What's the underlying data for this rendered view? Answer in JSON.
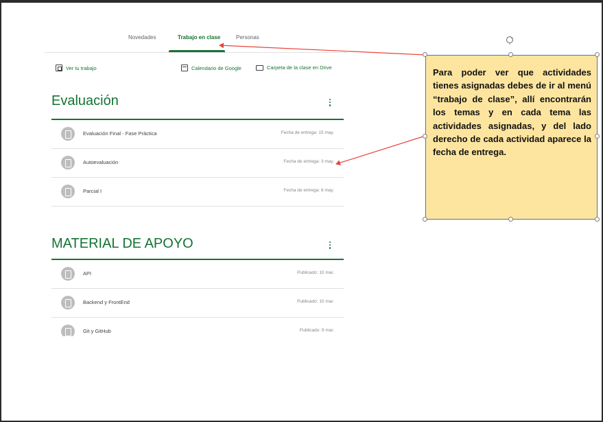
{
  "tabs": [
    {
      "label": "Novedades",
      "active": false
    },
    {
      "label": "Trabajo en clase",
      "active": true
    },
    {
      "label": "Personas",
      "active": false
    }
  ],
  "actions": {
    "view_work": "Ver tu trabajo",
    "google_calendar": "Calendario de Google",
    "drive_folder": "Carpeta de la clase en Drive"
  },
  "sections": [
    {
      "title": "Evaluación",
      "items": [
        {
          "title": "Evaluación Final - Fase Práctica",
          "date": "Fecha de entrega: 15 may."
        },
        {
          "title": "Autoevaluación",
          "date": "Fecha de entrega: 3 may."
        },
        {
          "title": "Parcial I",
          "date": "Fecha de entrega: 6 may."
        }
      ]
    },
    {
      "title": "MATERIAL DE APOYO",
      "items": [
        {
          "title": "API",
          "date": "Publicado: 10 mar."
        },
        {
          "title": "Backend y FrontEnd",
          "date": "Publicado: 10 mar."
        },
        {
          "title": "Git y GitHub",
          "date": "Publicado: 9 mar."
        }
      ]
    }
  ],
  "callout": {
    "text": "Para poder ver que actividades tienes asignadas debes de ir al menú “trabajo de clase”, allí encontrarán los temas y en cada tema las actividades asignadas, y del lado derecho de cada actividad aparece la fecha de entrega."
  },
  "colors": {
    "accent": "#137333",
    "callout_fill": "#fde5a0",
    "callout_border": "#4472c4",
    "arrow": "#e8453c"
  },
  "icons": {
    "view_work": "assignment-icon",
    "calendar": "calendar-icon",
    "folder": "folder-icon",
    "more": "more-vert-icon",
    "row": "assignment-icon"
  }
}
